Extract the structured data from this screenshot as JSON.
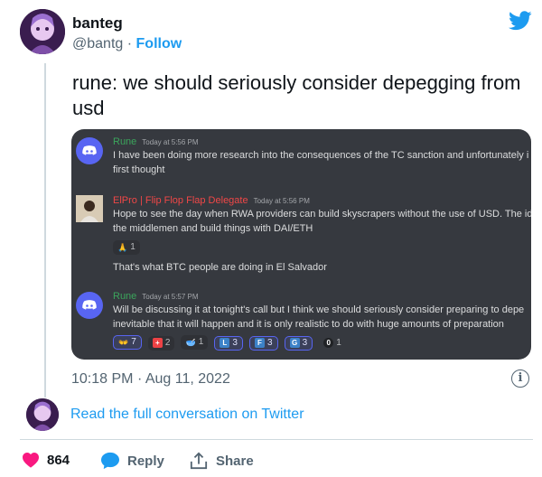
{
  "author": {
    "name": "banteg",
    "handle": "@bantg",
    "separator": "·",
    "follow_label": "Follow"
  },
  "tweet": {
    "text": "rune: we should seriously consider depegging from usd"
  },
  "discord": {
    "messages": [
      {
        "author": "Rune",
        "author_color": "#3ba55c",
        "time": "Today at 5:56 PM",
        "lines": [
          "I have been doing more research into the consequences of the TC sanction and unfortunately i",
          "first thought"
        ]
      },
      {
        "author": "ElPro | Flip Flop Flap Delegate",
        "author_color": "#f04747",
        "time": "Today at 5:56 PM",
        "lines": [
          "Hope to see the day when RWA providers can build skyscrapers without the use of USD. The id",
          "the middlemen and build things with DAI/ETH"
        ],
        "reactions": [
          {
            "emoji": "🙏",
            "count": "1"
          }
        ],
        "followup": "That's what BTC people are doing in El Salvador"
      },
      {
        "author": "Rune",
        "author_color": "#3ba55c",
        "time": "Today at 5:57 PM",
        "lines": [
          "Will be discussing it at tonight's call but I think we should seriously consider preparing to depe",
          "inevitable that it will happen and it is only realistic to do with huge amounts of preparation"
        ],
        "reactions": [
          {
            "emoji": "👐",
            "count": "7",
            "active": true
          },
          {
            "emoji": "+",
            "count": "2"
          },
          {
            "emoji": "🥣",
            "count": "1"
          },
          {
            "emoji": "L",
            "count": "3",
            "active": true
          },
          {
            "emoji": "F",
            "count": "3",
            "active": true
          },
          {
            "emoji": "G",
            "count": "3",
            "active": true
          },
          {
            "emoji": "0",
            "count": "1"
          }
        ]
      }
    ]
  },
  "meta": {
    "time": "10:18 PM",
    "separator": "·",
    "date": "Aug 11, 2022"
  },
  "read_full_label": "Read the full conversation on Twitter",
  "actions": {
    "like_count": "864",
    "reply_label": "Reply",
    "share_label": "Share"
  },
  "colors": {
    "twitter_blue": "#1d9bf0",
    "like_red": "#f91880",
    "discord_bg": "#36393f",
    "blurple": "#5865f2"
  }
}
